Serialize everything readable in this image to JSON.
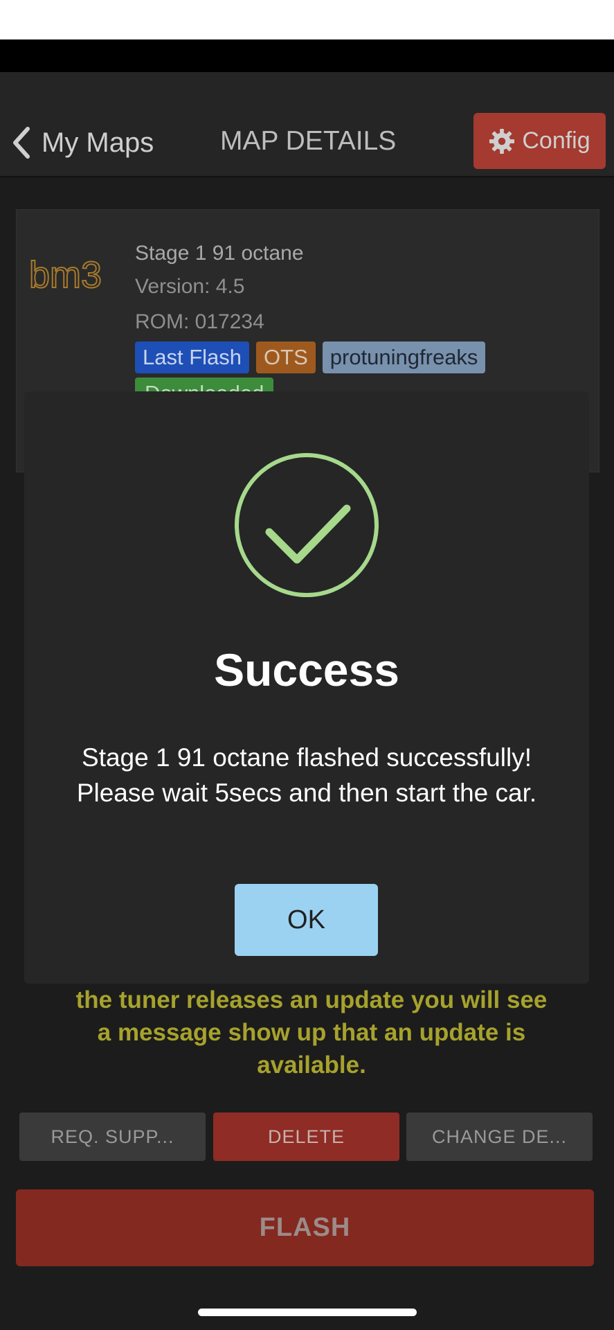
{
  "nav": {
    "back_label": "My Maps",
    "title": "MAP DETAILS",
    "config_label": "Config"
  },
  "map": {
    "brand": "bm3",
    "name": "Stage 1 91 octane",
    "version": "Version: 4.5",
    "rom": "ROM: 017234",
    "tags": [
      "Last Flash",
      "OTS",
      "protuningfreaks"
    ],
    "downloaded_label": "Downloaded"
  },
  "info_message": "the tuner releases an update you will see a message show up that an update is available.",
  "actions": {
    "request_support": "REQ. SUPP...",
    "delete": "DELETE",
    "change_description": "CHANGE DE...",
    "flash": "FLASH"
  },
  "dialog": {
    "title": "Success",
    "line1": "Stage 1 91 octane flashed successfully!",
    "line2": "Please wait 5secs and then start the car.",
    "ok_label": "OK"
  },
  "colors": {
    "accent_red": "#a43a30",
    "success_green": "#a6d98c",
    "ok_blue": "#9bd2f1",
    "message_yellow": "#a6a22d"
  }
}
